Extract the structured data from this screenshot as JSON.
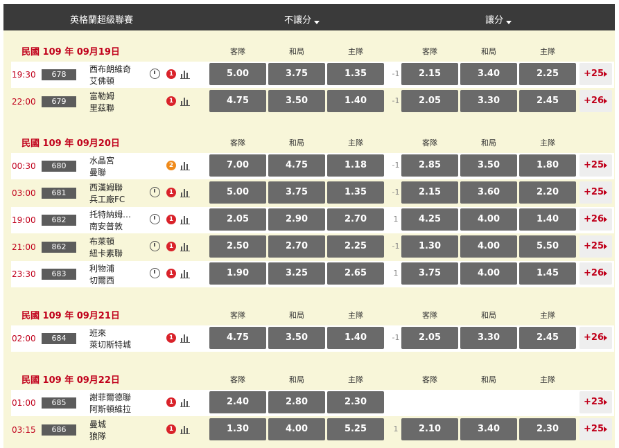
{
  "header": {
    "league": "英格蘭超級聯賽",
    "no_handicap": "不讓分",
    "handicap": "讓分"
  },
  "columns": {
    "away": "客隊",
    "draw": "和局",
    "home": "主隊"
  },
  "sections": [
    {
      "date": "民國 109 年 09月19日",
      "matches": [
        {
          "time": "19:30",
          "code": "678",
          "away": "西布朗維奇",
          "home": "艾佛頓",
          "timer": true,
          "badge": "1",
          "odds": [
            "5.00",
            "3.75",
            "1.35"
          ],
          "hc_label": "-1",
          "hc_odds": [
            "2.15",
            "3.40",
            "2.25"
          ],
          "more": "+25"
        },
        {
          "time": "22:00",
          "code": "679",
          "away": "富勒姆",
          "home": "里茲聯",
          "timer": false,
          "badge": "1",
          "odds": [
            "4.75",
            "3.50",
            "1.40"
          ],
          "hc_label": "-1",
          "hc_odds": [
            "2.05",
            "3.30",
            "2.45"
          ],
          "more": "+26"
        }
      ]
    },
    {
      "date": "民國 109 年 09月20日",
      "matches": [
        {
          "time": "00:30",
          "code": "680",
          "away": "水晶宮",
          "home": "曼聯",
          "timer": false,
          "badge": "2",
          "badge_color": "orange",
          "odds": [
            "7.00",
            "4.75",
            "1.18"
          ],
          "hc_label": "-1",
          "hc_odds": [
            "2.85",
            "3.50",
            "1.80"
          ],
          "more": "+25"
        },
        {
          "time": "03:00",
          "code": "681",
          "away": "西漢姆聯",
          "home": "兵工廠FC",
          "timer": true,
          "badge": "1",
          "odds": [
            "5.00",
            "3.75",
            "1.35"
          ],
          "hc_label": "-1",
          "hc_odds": [
            "2.15",
            "3.60",
            "2.20"
          ],
          "more": "+25"
        },
        {
          "time": "19:00",
          "code": "682",
          "away": "托特納姆…",
          "home": "南安普敦",
          "timer": true,
          "badge": "1",
          "odds": [
            "2.05",
            "2.90",
            "2.70"
          ],
          "hc_label": "1",
          "hc_odds": [
            "4.25",
            "4.00",
            "1.40"
          ],
          "more": "+26"
        },
        {
          "time": "21:00",
          "code": "862",
          "away": "布萊頓",
          "home": "紐卡素聯",
          "timer": true,
          "badge": "1",
          "odds": [
            "2.50",
            "2.70",
            "2.25"
          ],
          "hc_label": "-1",
          "hc_odds": [
            "1.30",
            "4.00",
            "5.50"
          ],
          "more": "+25"
        },
        {
          "time": "23:30",
          "code": "683",
          "away": "利物浦",
          "home": "切爾西",
          "timer": true,
          "badge": "1",
          "odds": [
            "1.90",
            "3.25",
            "2.65"
          ],
          "hc_label": "1",
          "hc_odds": [
            "3.75",
            "4.00",
            "1.45"
          ],
          "more": "+26"
        }
      ]
    },
    {
      "date": "民國 109 年 09月21日",
      "matches": [
        {
          "time": "02:00",
          "code": "684",
          "away": "班來",
          "home": "萊切斯特城",
          "timer": false,
          "badge": "1",
          "odds": [
            "4.75",
            "3.50",
            "1.40"
          ],
          "hc_label": "-1",
          "hc_odds": [
            "2.05",
            "3.30",
            "2.45"
          ],
          "more": "+26"
        }
      ]
    },
    {
      "date": "民國 109 年 09月22日",
      "matches": [
        {
          "time": "01:00",
          "code": "685",
          "away": "謝菲爾德聯",
          "home": "阿斯頓維拉",
          "timer": false,
          "badge": "1",
          "odds": [
            "2.40",
            "2.80",
            "2.30"
          ],
          "hc_label": "",
          "hc_odds": [],
          "more": "+23"
        },
        {
          "time": "03:15",
          "code": "686",
          "away": "曼城",
          "home": "狼隊",
          "timer": false,
          "badge": "1",
          "odds": [
            "1.30",
            "4.00",
            "5.25"
          ],
          "hc_label": "1",
          "hc_odds": [
            "2.10",
            "3.40",
            "2.30"
          ],
          "more": "+25"
        }
      ]
    }
  ]
}
